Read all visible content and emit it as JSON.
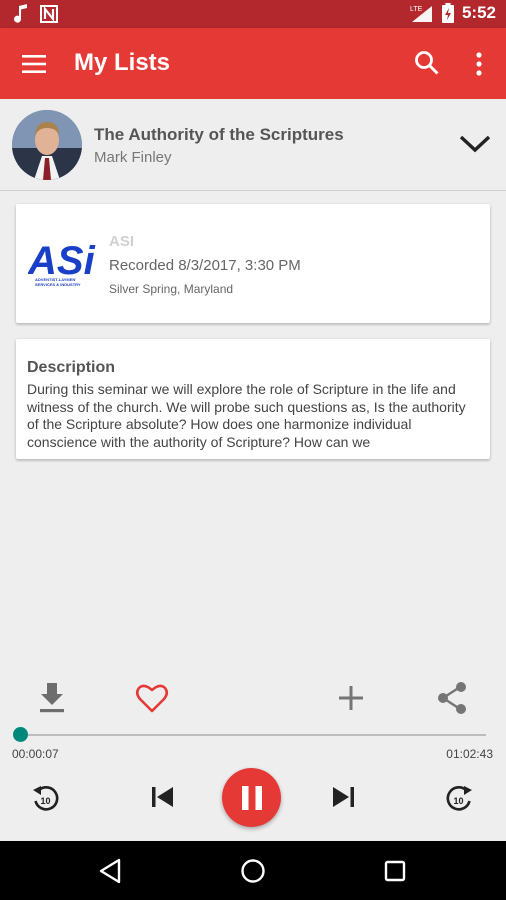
{
  "status_bar": {
    "icons": [
      "music-note-icon",
      "n-notification-icon",
      "lte-signal-icon",
      "battery-charging-icon"
    ],
    "network_label": "LTE",
    "time": "5:52"
  },
  "app_bar": {
    "title": "My Lists",
    "icons": [
      "menu-icon",
      "search-icon",
      "more-vert-icon"
    ],
    "color": "#e53935"
  },
  "now_playing": {
    "title": "The Authority of the Scriptures",
    "artist": "Mark Finley"
  },
  "info": {
    "logo_text": "ASi",
    "logo_subtext": "ADVENTIST-LAYMEN' SERVICES & INDUSTRY",
    "organization": "ASI",
    "recorded": "Recorded 8/3/2017, 3:30 PM",
    "location": "Silver Spring, Maryland"
  },
  "description": {
    "heading": "Description",
    "text": "During this seminar we will explore the role of Scripture in the life and witness of the church. We will probe such questions as, Is the authority of the Scripture absolute? How does one harmonize individual conscience with the authority of Scripture? How can we"
  },
  "actions": [
    "download-icon",
    "favorite-heart-icon",
    "add-icon",
    "share-icon"
  ],
  "player": {
    "elapsed": "00:00:07",
    "total": "01:02:43",
    "progress_fraction": 0.002,
    "accent": "#00897b",
    "controls": [
      "replay-10-icon",
      "skip-previous-icon",
      "pause-icon",
      "skip-next-icon",
      "forward-10-icon"
    ],
    "skip_seconds": "10"
  },
  "nav_bar": {
    "buttons": [
      "back-icon",
      "home-icon",
      "recents-icon"
    ]
  }
}
